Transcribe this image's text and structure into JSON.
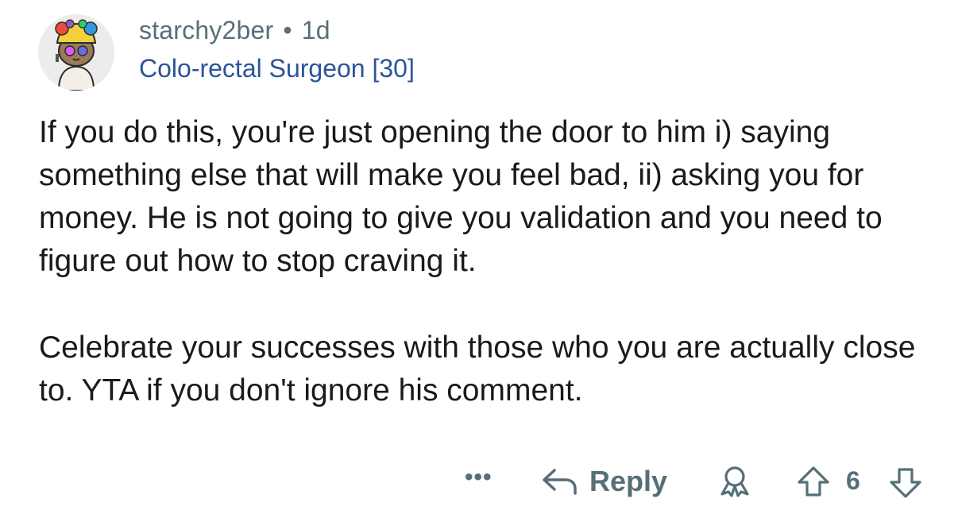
{
  "comment": {
    "author": "starchy2ber",
    "separator": "•",
    "age": "1d",
    "flair": "Colo-rectal Surgeon [30]",
    "paragraphs": [
      "If you do this, you're just opening the door to him i) saying something else that will make you feel bad, ii) asking you for money. He is not going to give you validation and you need to figure out how to stop craving it.",
      "Celebrate your successes with those who you are actually close to. YTA if you don't ignore his comment."
    ],
    "avatar_icon": "snoo-avatar-icon"
  },
  "actions": {
    "more_label": "•••",
    "reply_label": "Reply",
    "reply_icon": "reply-arrow-icon",
    "award_icon": "award-icon",
    "upvote_icon": "upvote-arrow-icon",
    "vote_count": "6",
    "downvote_icon": "downvote-arrow-icon"
  },
  "colors": {
    "meta_text": "#576f76",
    "flair_text": "#2a5598",
    "body_text": "#1a1a1b",
    "background": "#ffffff"
  }
}
